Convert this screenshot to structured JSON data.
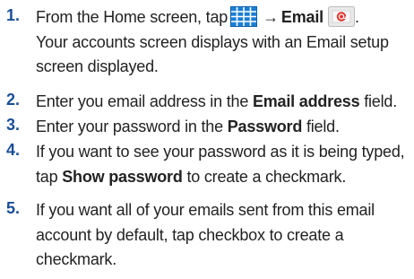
{
  "steps": [
    {
      "num": "1.",
      "line1_pre": "From the Home screen, tap",
      "arrow": "→",
      "line1_bold": "Email",
      "line1_post": ".",
      "line2": "Your accounts screen displays with an Email setup",
      "line3": "screen displayed.",
      "icons": [
        "apps-grid-icon",
        "email-app-icon"
      ]
    },
    {
      "num": "2.",
      "pre": "Enter you email address in the ",
      "bold": "Email address",
      "post": " field."
    },
    {
      "num": "3.",
      "pre": "Enter your password in the ",
      "bold": "Password",
      "post": " field."
    },
    {
      "num": "4.",
      "line1": "If you want to see your password as it is being typed,",
      "pre": "tap ",
      "bold": "Show password",
      "post": " to create a checkmark."
    },
    {
      "num": "5.",
      "line1": "If you want all of your emails sent from this email",
      "line2": "account by default, tap checkbox to create a",
      "line3": "checkmark."
    }
  ],
  "colors": {
    "step_number": "#1a4e97",
    "body_text": "#222222",
    "apps_icon": "#1b7fd6",
    "email_icon_bg": "#e9e9e9",
    "email_icon_accent": "#e0302a"
  }
}
